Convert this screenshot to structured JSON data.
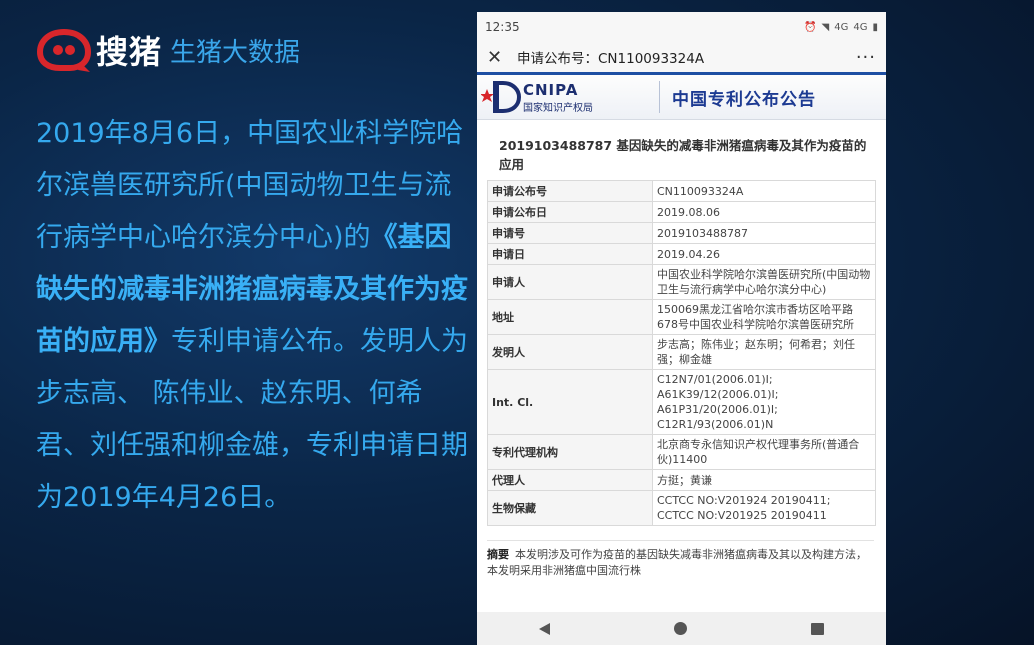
{
  "brand": {
    "name": "搜猪",
    "subtitle": "生猪大数据"
  },
  "slide": {
    "text_before": "2019年8月6日，中国农业科学院哈尔滨兽医研究所(中国动物卫生与流行病学中心哈尔滨分中心)的",
    "emphasis": "《基因缺失的减毒非洲猪瘟病毒及其作为疫苗的应用》",
    "text_after": "专利申请公布。发明人为步志高、 陈伟业、赵东明、何希君、刘任强和柳金雄，专利申请日期为2019年4月26日。"
  },
  "phone": {
    "time": "12:35",
    "status_icons": [
      "alarm-icon",
      "wifi-icon",
      "signal-4g-icon",
      "signal-4g-icon",
      "battery-icon"
    ],
    "status_labels": {
      "net1": "4G",
      "net2": "4G"
    },
    "appbar_title": "申请公布号：CN110093324A",
    "more_label": "···",
    "cnipa_en": "CNIPA",
    "cnipa_cn": "国家知识产权局",
    "banner_title": "中国专利公布公告",
    "doc_title": "2019103488787 基因缺失的减毒非洲猪瘟病毒及其作为疫苗的应用",
    "rows": [
      {
        "k": "申请公布号",
        "v": "CN110093324A"
      },
      {
        "k": "申请公布日",
        "v": "2019.08.06"
      },
      {
        "k": "申请号",
        "v": "2019103488787"
      },
      {
        "k": "申请日",
        "v": "2019.04.26"
      },
      {
        "k": "申请人",
        "v": "中国农业科学院哈尔滨兽医研究所(中国动物卫生与流行病学中心哈尔滨分中心)"
      },
      {
        "k": "地址",
        "v": "150069黑龙江省哈尔滨市香坊区哈平路678号中国农业科学院哈尔滨兽医研究所"
      },
      {
        "k": "发明人",
        "v": "步志高；陈伟业；赵东明；何希君；刘任强；柳金雄"
      },
      {
        "k": "Int. Cl.",
        "v": "C12N7/01(2006.01)I;\nA61K39/12(2006.01)I;\nA61P31/20(2006.01)I;\nC12R1/93(2006.01)N"
      },
      {
        "k": "专利代理机构",
        "v": "北京商专永信知识产权代理事务所(普通合伙)11400"
      },
      {
        "k": "代理人",
        "v": "方挺；黄谦"
      },
      {
        "k": "生物保藏",
        "v": "CCTCC NO:V201924 20190411;\nCCTCC NO:V201925 20190411"
      }
    ],
    "abstract_label": "摘要",
    "abstract_text": "本发明涉及可作为疫苗的基因缺失减毒非洲猪瘟病毒及其以及构建方法，本发明采用非洲猪瘟中国流行株"
  }
}
